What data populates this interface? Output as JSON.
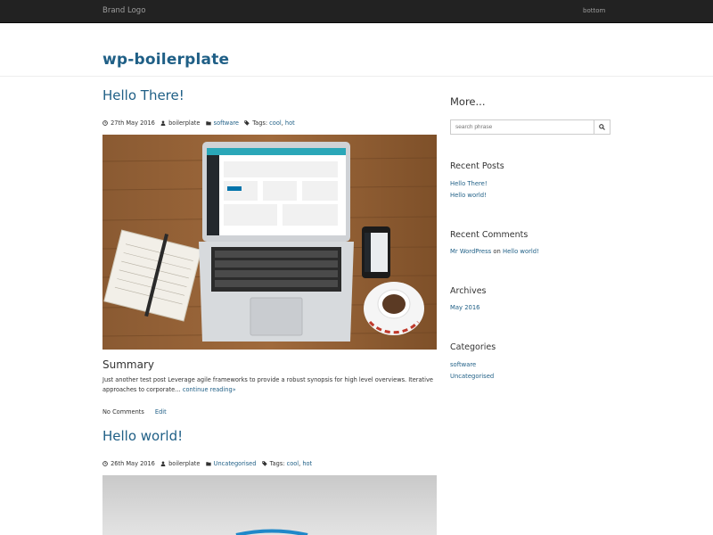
{
  "navbar": {
    "brand": "Brand Logo",
    "link": "bottom"
  },
  "site": {
    "title": "wp-boilerplate"
  },
  "posts": [
    {
      "title": "Hello There!",
      "date": "27th May 2016",
      "author": "boilerplate",
      "category": "software",
      "tags_label": "Tags:",
      "tags": [
        "cool",
        "hot"
      ],
      "summary_heading": "Summary",
      "excerpt": "Just another test post Leverage agile frameworks to provide a robust synopsis for high level overviews. Iterative approaches to corporate…",
      "read_more": "continue reading»",
      "comments": "No Comments",
      "edit": "Edit"
    },
    {
      "title": "Hello world!",
      "date": "26th May 2016",
      "author": "boilerplate",
      "category": "Uncategorised",
      "tags_label": "Tags:",
      "tags": [
        "cool",
        "hot"
      ]
    }
  ],
  "sidebar": {
    "more_heading": "More...",
    "search_placeholder": "search phrase",
    "recent_posts_heading": "Recent Posts",
    "recent_posts": [
      "Hello There!",
      "Hello world!"
    ],
    "recent_comments_heading": "Recent Comments",
    "recent_comment": {
      "author": "Mr WordPress",
      "on": "on",
      "post": "Hello world!"
    },
    "archives_heading": "Archives",
    "archives": [
      "May 2016"
    ],
    "categories_heading": "Categories",
    "categories": [
      "software",
      "Uncategorised"
    ]
  },
  "colors": {
    "navbar": "#222222",
    "link": "#1f5f86",
    "text": "#333333"
  },
  "icons": [
    "clock-icon",
    "user-icon",
    "folder-icon",
    "tags-icon",
    "search-icon"
  ]
}
